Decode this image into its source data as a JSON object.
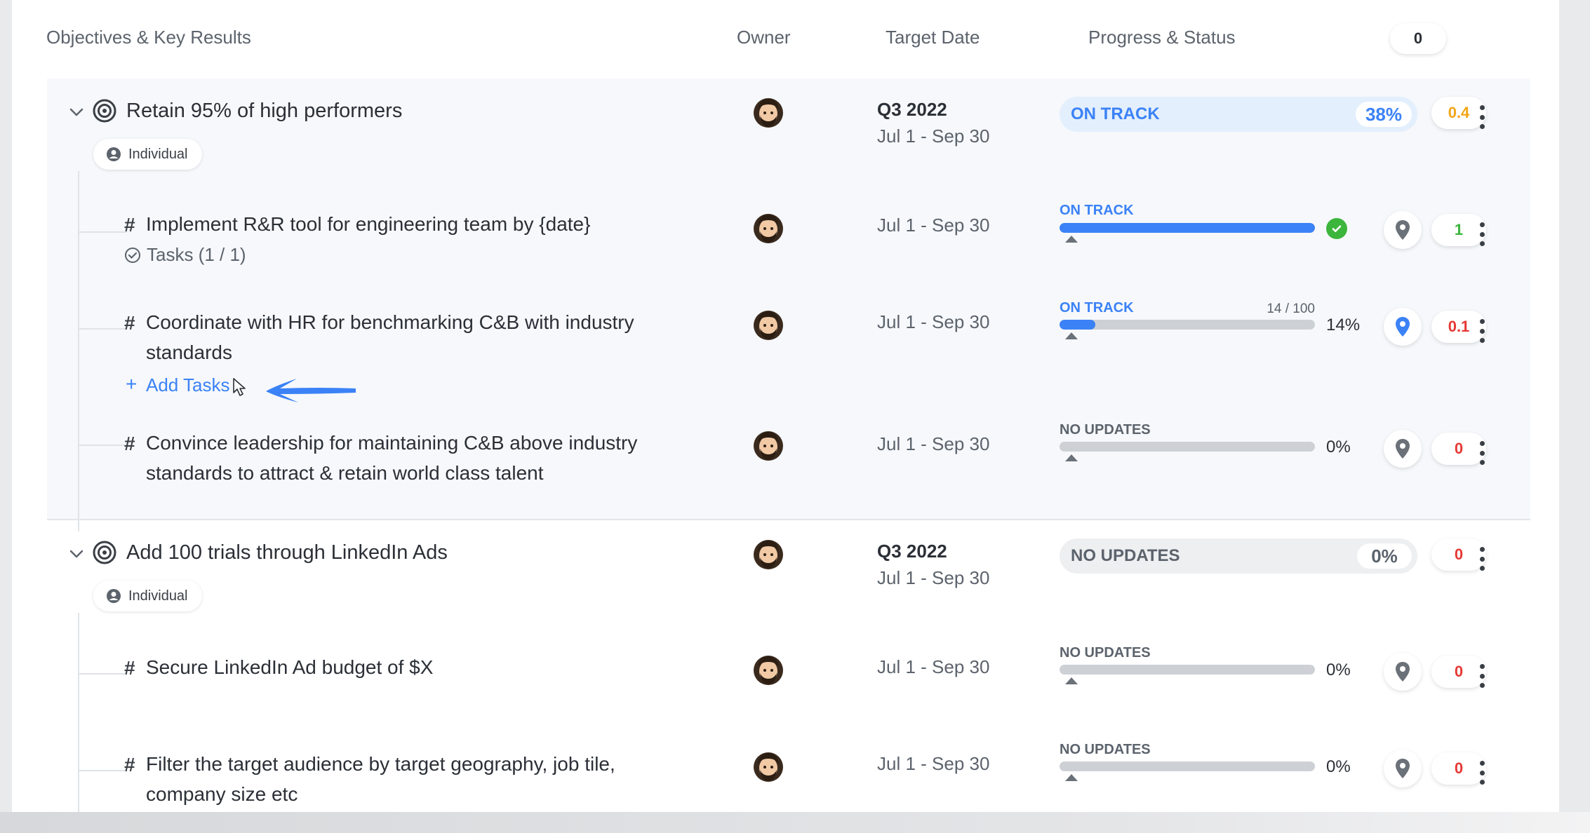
{
  "header": {
    "col_okr": "Objectives & Key Results",
    "col_owner": "Owner",
    "col_target": "Target Date",
    "col_progress": "Progress & Status",
    "count": "0"
  },
  "colors": {
    "accent": "#3b82f6",
    "on_track": "#3b82f6",
    "success": "#3cb53c",
    "warning": "#f2a516",
    "danger": "#e53935",
    "neutral": "#5c636c"
  },
  "objectives": [
    {
      "title": "Retain 95% of high performers",
      "icon": "target-icon",
      "chip": "Individual",
      "quarter": "Q3 2022",
      "range": "Jul 1 - Sep 30",
      "status": "ON TRACK",
      "percent": "38%",
      "progress": 0.38,
      "score": "0.4",
      "key_results": [
        {
          "title": "Implement R&R tool for engineering team by {date}",
          "tasks": "Tasks (1 / 1)",
          "range": "Jul 1 - Sep 30",
          "status": "ON TRACK",
          "progress": 1.0,
          "completed": true,
          "score": "1"
        },
        {
          "title": "Coordinate with HR for benchmarking C&B with industry standards",
          "add_tasks": "Add Tasks",
          "range": "Jul 1 - Sep 30",
          "status": "ON TRACK",
          "fraction": "14 / 100",
          "percent": "14%",
          "progress": 0.14,
          "score": "0.1"
        },
        {
          "title": "Convince leadership for maintaining C&B above industry standards to attract & retain world class talent",
          "range": "Jul 1 - Sep 30",
          "status": "NO UPDATES",
          "percent": "0%",
          "progress": 0,
          "score": "0"
        }
      ]
    },
    {
      "title": "Add 100 trials through LinkedIn Ads",
      "icon": "target-icon",
      "chip": "Individual",
      "quarter": "Q3 2022",
      "range": "Jul 1 - Sep 30",
      "status": "NO UPDATES",
      "percent": "0%",
      "progress": 0,
      "score": "0",
      "key_results": [
        {
          "title": "Secure LinkedIn Ad budget of $X",
          "range": "Jul 1 - Sep 30",
          "status": "NO UPDATES",
          "percent": "0%",
          "progress": 0,
          "score": "0"
        },
        {
          "title": "Filter the target audience by target geography, job tile, company size etc",
          "range": "Jul 1 - Sep 30",
          "status": "NO UPDATES",
          "percent": "0%",
          "progress": 0,
          "score": "0"
        }
      ]
    }
  ]
}
